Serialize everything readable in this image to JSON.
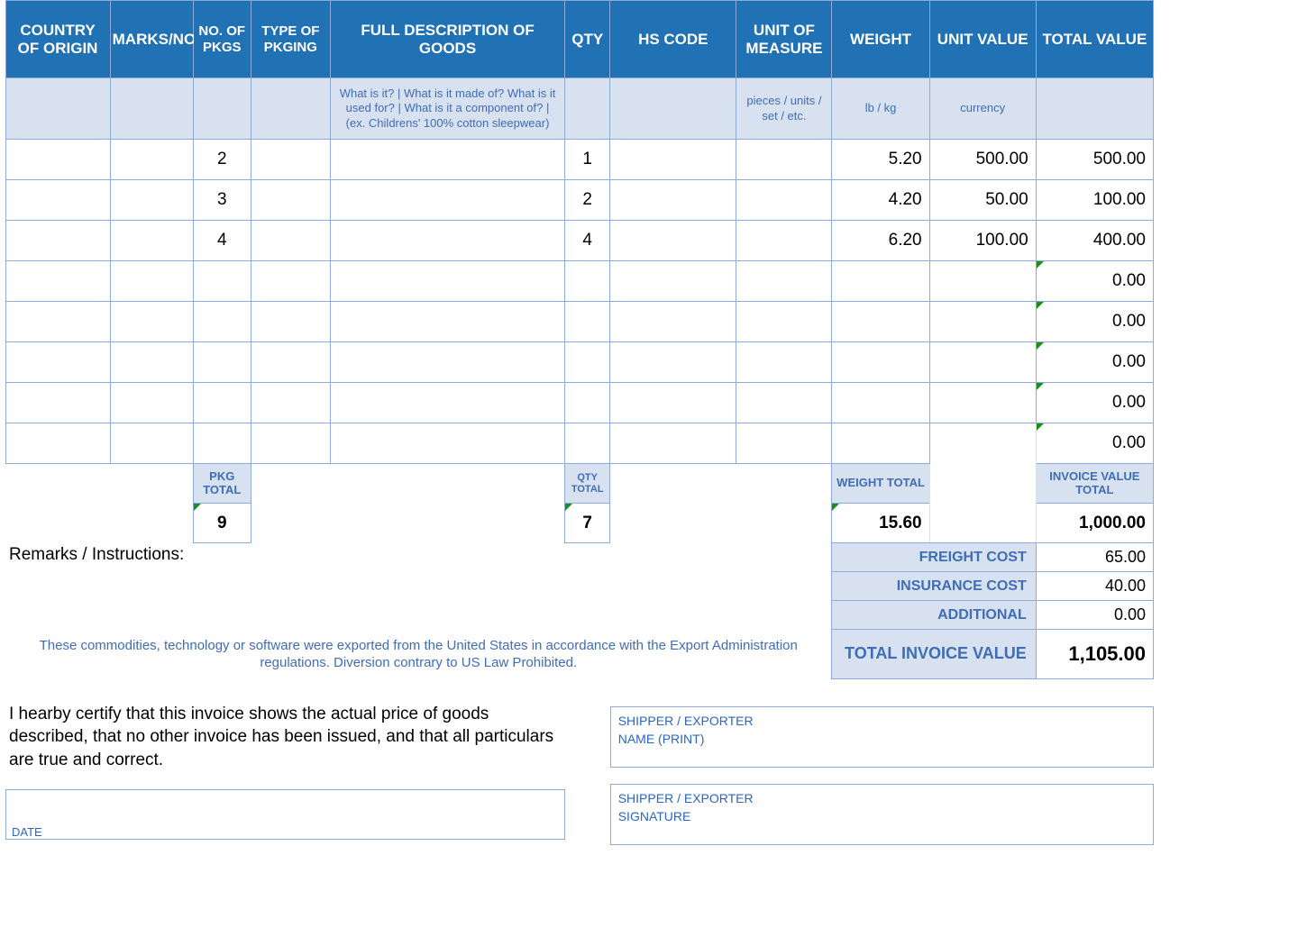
{
  "headers": {
    "country": "COUNTRY OF ORIGIN",
    "marks": "MARKS/NO's",
    "nopkgs": "NO. OF PKGS",
    "pkging": "TYPE OF PKGING",
    "desc": "FULL DESCRIPTION OF GOODS",
    "qty": "QTY",
    "hs": "HS CODE",
    "uom": "UNIT OF MEASURE",
    "weight": "WEIGHT",
    "unitval": "UNIT VALUE",
    "totalval": "TOTAL VALUE"
  },
  "hints": {
    "desc": "What is it? | What is it made of? What is it used for? | What is it a component of? | (ex. Childrens' 100% cotton sleepwear)",
    "uom": "pieces / units / set / etc.",
    "weight": "lb / kg",
    "unitval": "currency"
  },
  "rows": [
    {
      "pkgs": "2",
      "qty": "1",
      "weight": "5.20",
      "unitval": "500.00",
      "totalval": "500.00"
    },
    {
      "pkgs": "3",
      "qty": "2",
      "weight": "4.20",
      "unitval": "50.00",
      "totalval": "100.00"
    },
    {
      "pkgs": "4",
      "qty": "4",
      "weight": "6.20",
      "unitval": "100.00",
      "totalval": "400.00"
    },
    {
      "totalval": "0.00",
      "flag": true
    },
    {
      "totalval": "0.00",
      "flag": true
    },
    {
      "totalval": "0.00",
      "flag": true
    },
    {
      "totalval": "0.00",
      "flag": true
    },
    {
      "totalval": "0.00",
      "flag": true
    }
  ],
  "totals": {
    "pkg_label": "PKG TOTAL",
    "qty_label": "QTY TOTAL",
    "weight_label": "WEIGHT TOTAL",
    "invval_label": "INVOICE VALUE TOTAL",
    "pkg": "9",
    "qty": "7",
    "weight": "15.60",
    "invval": "1,000.00"
  },
  "costs": {
    "freight_label": "FREIGHT COST",
    "freight": "65.00",
    "ins_label": "INSURANCE COST",
    "ins": "40.00",
    "add_label": "ADDITIONAL",
    "add": "0.00",
    "grand_label": "TOTAL INVOICE VALUE",
    "grand": "1,105.00"
  },
  "text": {
    "remarks": "Remarks / Instructions:",
    "disclaimer": "These commodities, technology or software were exported from the United States in accordance with the Export Administration regulations.  Diversion contrary to US Law Prohibited.",
    "certify": "I hearby certify that this invoice shows the actual price of goods described, that no other invoice has been issued, and that all particulars are true and correct.",
    "date": "DATE",
    "shipper_name1": "SHIPPER / EXPORTER",
    "shipper_name2": "NAME (PRINT)",
    "shipper_sig1": "SHIPPER / EXPORTER",
    "shipper_sig2": "SIGNATURE"
  }
}
